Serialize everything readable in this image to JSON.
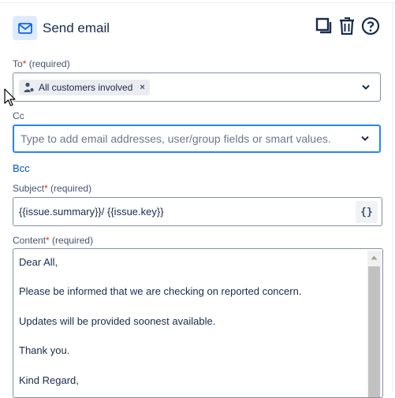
{
  "header": {
    "title": "Send email"
  },
  "to_field": {
    "label": "To",
    "required_mark": "*",
    "required_note": "(required)",
    "chip_label": "All customers involved",
    "chip_remove": "×"
  },
  "cc_field": {
    "label": "Cc",
    "placeholder": "Type to add email addresses, user/group fields or smart values."
  },
  "bcc_link": "Bcc",
  "subject_field": {
    "label": "Subject",
    "required_mark": "*",
    "required_note": "(required)",
    "value": "{{issue.summary}}/ {{issue.key}}",
    "smart_value_button": "{}"
  },
  "content_field": {
    "label": "Content",
    "required_mark": "*",
    "required_note": "(required)",
    "lines": [
      "Dear All,",
      "Please be informed that we are checking on reported concern.",
      "Updates will be provided soonest available.",
      "Thank you.",
      "Kind Regard,"
    ]
  },
  "icons": {
    "action": "mail-icon",
    "duplicate": "duplicate-icon",
    "delete": "trash-icon",
    "help": "help-icon",
    "chip": "customers-icon",
    "dropdown": "chevron-down-icon",
    "scroll_up": "arrow-up-icon",
    "cursor": "mouse-pointer-icon"
  },
  "colors": {
    "accent": "#0052cc",
    "focus_border": "#2684ff",
    "required": "#de350b",
    "icon_bg": "#deebff"
  }
}
